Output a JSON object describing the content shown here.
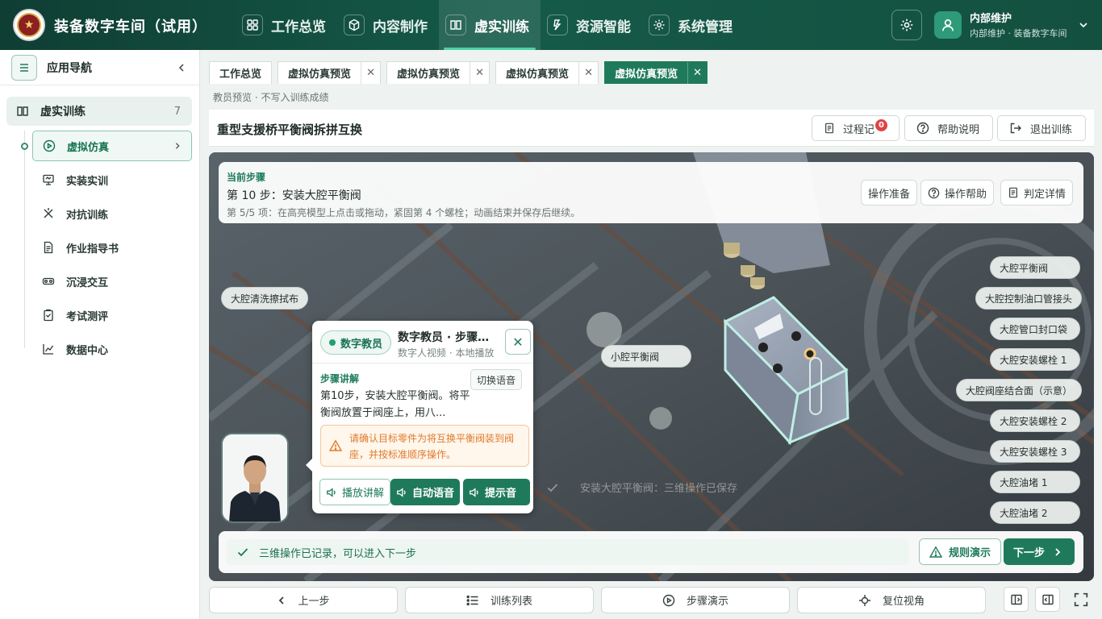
{
  "app": {
    "title": "装备数字车间（试用）",
    "logo_glyph": "★"
  },
  "topnav": [
    {
      "label": "工作总览",
      "icon": "grid-icon"
    },
    {
      "label": "内容制作",
      "icon": "cube-icon"
    },
    {
      "label": "虚实训练",
      "icon": "book-icon",
      "active": true
    },
    {
      "label": "资源智能",
      "icon": "lightning-icon"
    },
    {
      "label": "系统管理",
      "icon": "gear-icon"
    }
  ],
  "user": {
    "name": "内部维护",
    "sub": "内部维护 · 装备数字车间"
  },
  "sidebar": {
    "title": "应用导航",
    "group": {
      "label": "虚实训练",
      "count": "7"
    },
    "items": [
      {
        "label": "虚拟仿真",
        "icon": "play-circle-icon",
        "active": true
      },
      {
        "label": "实装实训",
        "icon": "monitor-icon"
      },
      {
        "label": "对抗训练",
        "icon": "fight-icon"
      },
      {
        "label": "作业指导书",
        "icon": "document-icon"
      },
      {
        "label": "沉浸交互",
        "icon": "vr-icon"
      },
      {
        "label": "考试测评",
        "icon": "clipboard-icon"
      },
      {
        "label": "数据中心",
        "icon": "chart-icon"
      }
    ]
  },
  "tabs": [
    {
      "label": "工作总览",
      "closable": false
    },
    {
      "label": "虚拟仿真预览",
      "closable": true
    },
    {
      "label": "虚拟仿真预览",
      "closable": true
    },
    {
      "label": "虚拟仿真预览",
      "closable": true
    },
    {
      "label": "虚拟仿真预览",
      "closable": true,
      "active": true
    }
  ],
  "close_glyph": "✕",
  "subnote": "教员预览 · 不写入训练成绩",
  "page": {
    "title": "重型支援桥平衡阀拆拼互换",
    "process_label": "过程记",
    "process_badge": "0",
    "help_label": "帮助说明",
    "exit_label": "退出训练"
  },
  "step": {
    "kicker": "当前步骤",
    "title": "第 10 步：安装大腔平衡阀",
    "detail": "第 5/5 项：在高亮模型上点击或拖动，紧固第 4 个螺栓；动画结束并保存后继续。",
    "btn_prepare": "操作准备",
    "btn_help": "操作帮助",
    "btn_judge": "判定详情"
  },
  "scene_tags": {
    "left": "大腔清洗擦拭布",
    "center": "小腔平衡阀",
    "right": [
      "大腔平衡阀",
      "大腔控制油口管接头",
      "大腔管口封口袋",
      "大腔安装螺栓 1",
      "大腔阀座结合面（示意）",
      "大腔安装螺栓 2",
      "大腔安装螺栓 3",
      "大腔油堵 1",
      "大腔油堵 2"
    ]
  },
  "ghost_toast": "安装大腔平衡阀：三维操作已保存",
  "teacher": {
    "chip": "数字教员",
    "name": "数字教员 · 步骤讲解",
    "sub": "数字人视频 · 本地播放",
    "section": "步骤讲解",
    "switch_voice": "切换语音",
    "body": "第10步，安装大腔平衡阀。将平衡阀放置于阀座上，用八...",
    "warning": "请确认目标零件为将互换平衡阀装到阀座，并按标准顺序操作。",
    "btn_play": "播放讲解",
    "btn_auto": "自动语音",
    "btn_tone": "提示音"
  },
  "record": {
    "text": "三维操作已记录，可以进入下一步",
    "rule_demo": "规则演示",
    "next": "下一步"
  },
  "bottom": {
    "prev": "上一步",
    "list": "训练列表",
    "demo": "步骤演示",
    "reset": "复位视角"
  },
  "colors": {
    "brand": "#1f7a5c",
    "header": "#155a49",
    "accent": "#4fd1a3",
    "warning": "#e07b2a",
    "badge": "#e04343"
  }
}
